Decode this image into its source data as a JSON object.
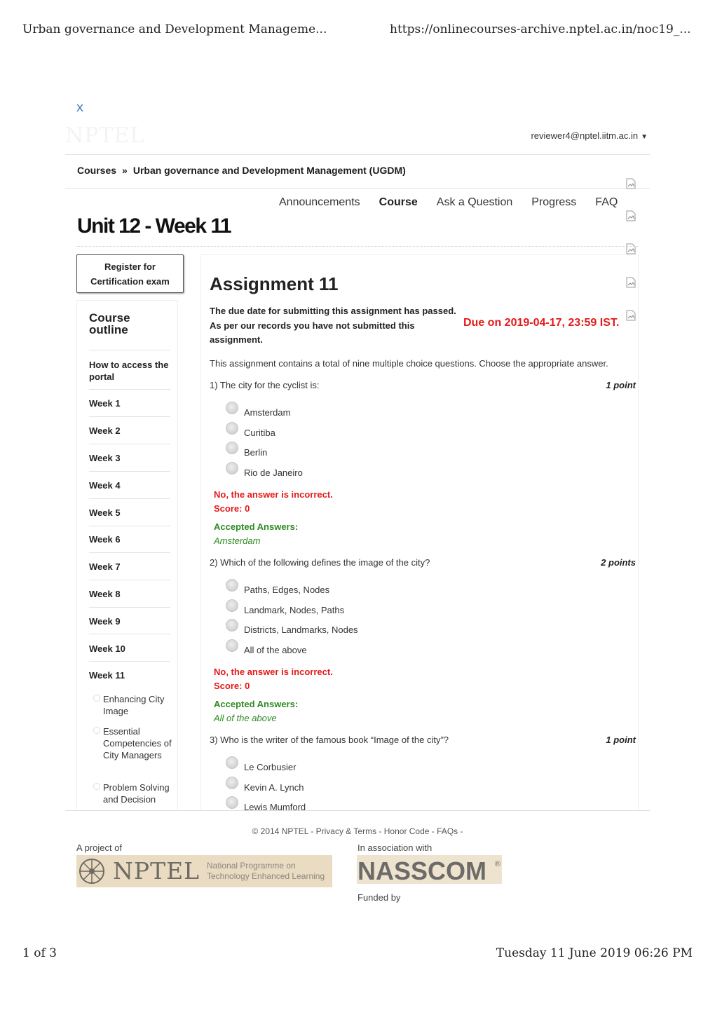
{
  "print_header": {
    "title": "Urban governance and Development Manageme...",
    "url": "https://onlinecourses-archive.nptel.ac.in/noc19_..."
  },
  "print_footer": {
    "page": "1 of 3",
    "datetime": "Tuesday 11 June 2019 06:26 PM"
  },
  "header": {
    "close_label": "X",
    "logo_text": "NPTEL",
    "user_email": "reviewer4@nptel.iitm.ac.in",
    "user_caret": "▼"
  },
  "breadcrumb": {
    "root": "Courses",
    "separator": "»",
    "course": "Urban governance and Development Management (UGDM)"
  },
  "nav": {
    "items": [
      {
        "label": "Announcements",
        "active": false
      },
      {
        "label": "Course",
        "active": true
      },
      {
        "label": "Ask a Question",
        "active": false
      },
      {
        "label": "Progress",
        "active": false
      },
      {
        "label": "FAQ",
        "active": false
      }
    ]
  },
  "page_title": "Unit 12 - Week 11",
  "register_button": {
    "line1": "Register for",
    "line2": "Certification exam"
  },
  "sidebar": {
    "title_line1": "Course",
    "title_line2": "outline",
    "items": [
      {
        "label": "How to access the portal"
      },
      {
        "label": "Week 1"
      },
      {
        "label": "Week 2"
      },
      {
        "label": "Week 3"
      },
      {
        "label": "Week 4"
      },
      {
        "label": "Week 5"
      },
      {
        "label": "Week 6"
      },
      {
        "label": "Week 7"
      },
      {
        "label": "Week 8"
      },
      {
        "label": "Week 9"
      },
      {
        "label": "Week 10"
      },
      {
        "label": "Week 11"
      }
    ],
    "lessons": [
      {
        "label": "Enhancing City Image"
      },
      {
        "label": "Essential Competencies of City Managers"
      },
      {
        "label": "Problem Solving and Decision"
      }
    ]
  },
  "assignment": {
    "title": "Assignment 11",
    "due_message_line1": "The due date for submitting this assignment has passed.",
    "due_message_line2": "As per our records you have not submitted this",
    "due_message_line3": "assignment.",
    "due_date": "Due on 2019-04-17, 23:59 IST.",
    "intro": "This assignment contains a total of nine multiple choice questions. Choose the appropriate answer.",
    "questions": [
      {
        "text": "1) The city for the cyclist is:",
        "points": "1 point",
        "options": [
          "Amsterdam",
          "Curitiba",
          "Berlin",
          "Rio de Janeiro"
        ],
        "feedback": "No, the answer is incorrect.",
        "score": "Score: 0",
        "accepted_label": "Accepted Answers:",
        "accepted_answer": "Amsterdam"
      },
      {
        "text": "2) Which of the following defines the image of the city?",
        "points": "2 points",
        "options": [
          "Paths, Edges, Nodes",
          "Landmark, Nodes, Paths",
          "Districts, Landmarks, Nodes",
          "All of the above"
        ],
        "feedback": "No, the answer is incorrect.",
        "score": "Score: 0",
        "accepted_label": "Accepted Answers:",
        "accepted_answer": "All of the above"
      },
      {
        "text": "3) Who is the writer of the famous book “Image of the city”?",
        "points": "1 point",
        "options": [
          "Le Corbusier",
          "Kevin A. Lynch",
          "Lewis Mumford"
        ]
      }
    ]
  },
  "footer": {
    "copyright": "© 2014 NPTEL -",
    "links": [
      "Privacy & Terms",
      "Honor Code",
      "FAQs"
    ],
    "link_sep": " - ",
    "project_label": "A project of",
    "association_label": "In association with",
    "funded_label": "Funded by",
    "nptel_logo_word": "NPTEL",
    "nptel_logo_sub1": "National Programme on",
    "nptel_logo_sub2": "Technology Enhanced Learning",
    "nasscom_logo_word": "NASSCOM",
    "nasscom_reg": "®"
  },
  "colors": {
    "error_red": "#e41a1a",
    "success_green": "#2e8b22",
    "link_blue": "#1a5fb4"
  }
}
